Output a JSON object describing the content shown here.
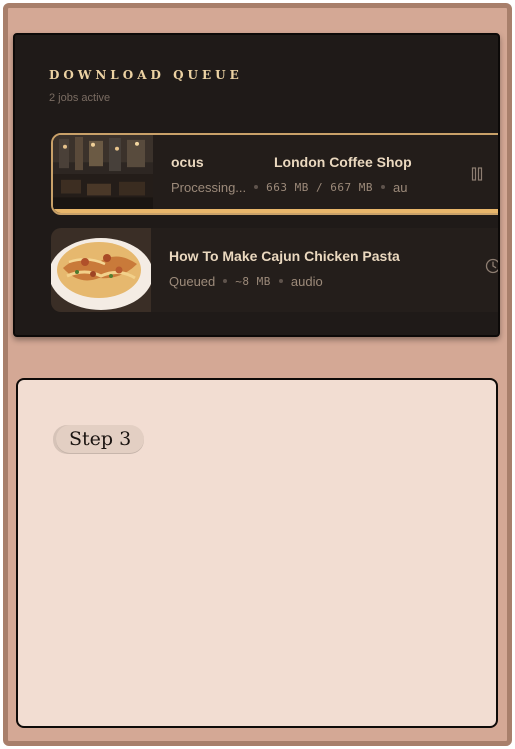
{
  "queue": {
    "title": "DOWNLOAD QUEUE",
    "subtitle": "2 jobs active",
    "jobs": [
      {
        "title_part1": "ocus",
        "title_part2": "London Coffee Shop",
        "status": "Processing...",
        "size": "663 MB / 667 MB",
        "format": "au",
        "progress": 0.99,
        "action_icon": "pause-icon",
        "thumbnail": "coffee-shop-thumbnail"
      },
      {
        "title": "How To Make Cajun Chicken Pasta",
        "status": "Queued",
        "size": "~8 MB",
        "format": "audio",
        "action_icon": "clock-icon",
        "thumbnail": "pasta-thumbnail"
      }
    ]
  },
  "step": {
    "label": "Step 3"
  },
  "colors": {
    "frame": "#d4a895",
    "panel": "#1f1a18",
    "accent": "#e8b66b",
    "step_panel": "#f2ddd2"
  }
}
